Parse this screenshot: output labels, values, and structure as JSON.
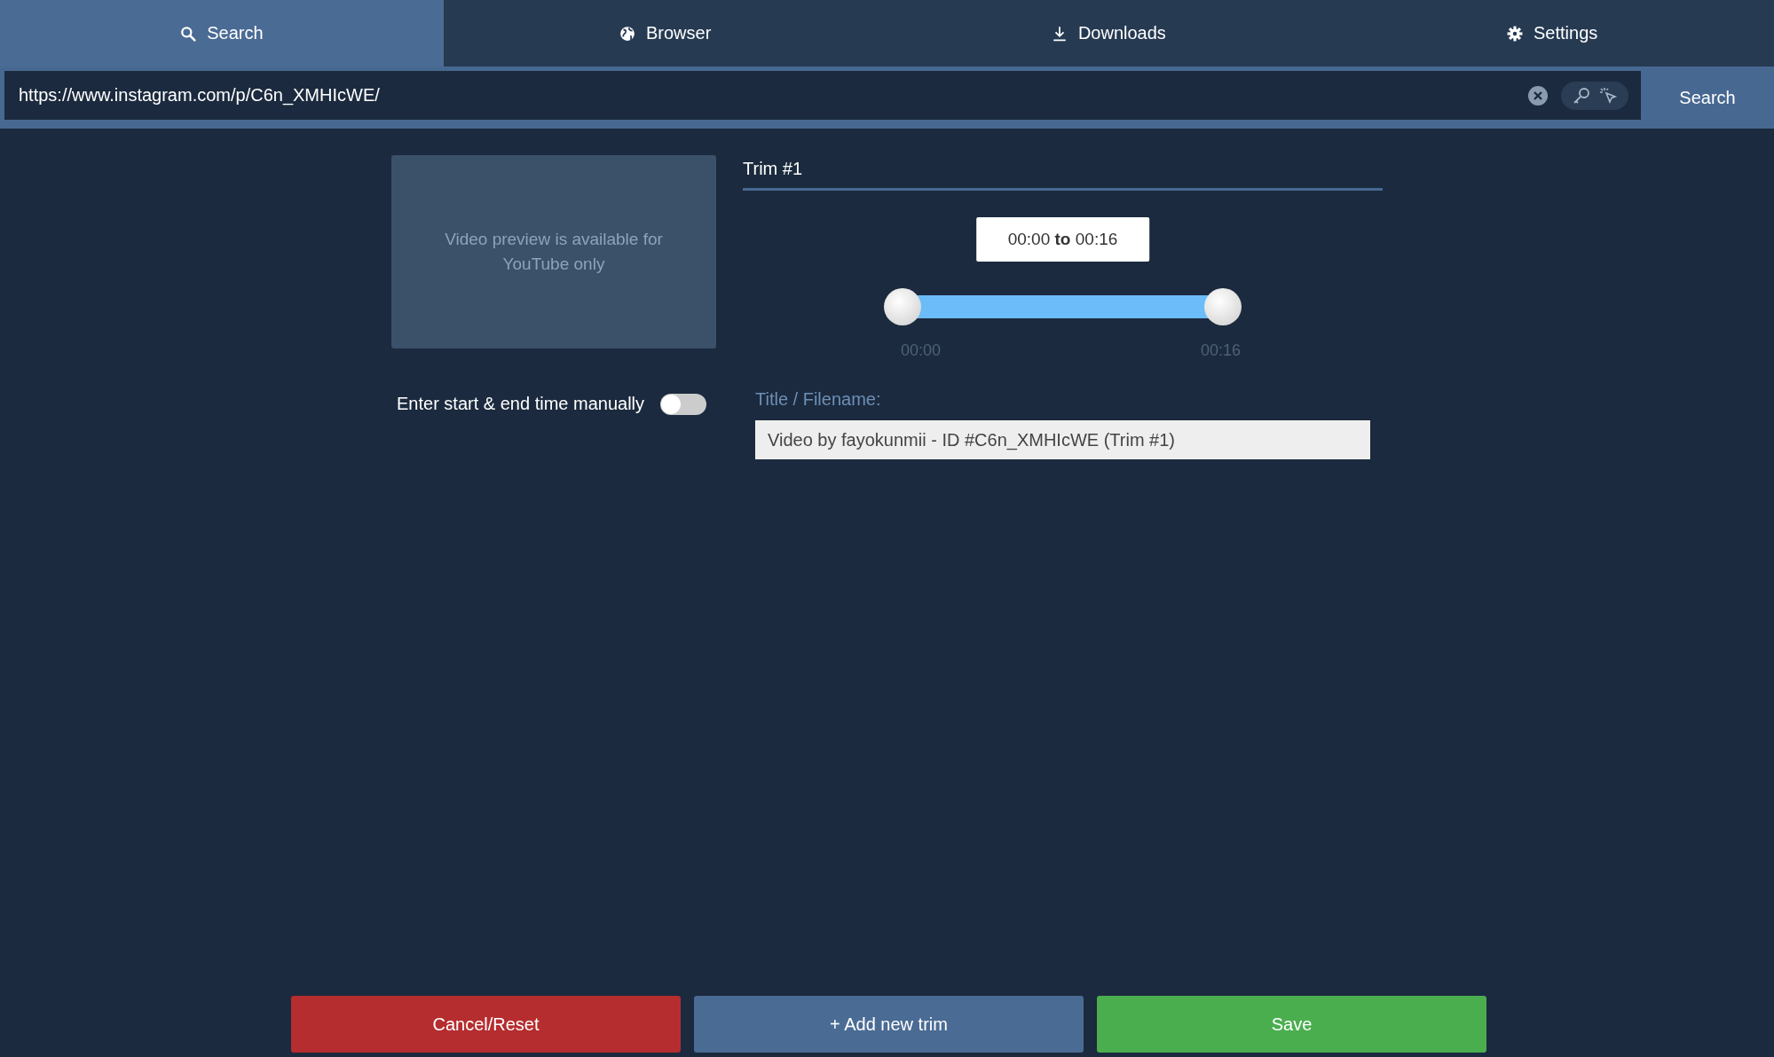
{
  "tabs": [
    {
      "label": "Search",
      "selected": true
    },
    {
      "label": "Browser",
      "selected": false
    },
    {
      "label": "Downloads",
      "selected": false
    },
    {
      "label": "Settings",
      "selected": false
    }
  ],
  "url_bar": {
    "value": "https://www.instagram.com/p/C6n_XMHIcWE/",
    "button": "Search"
  },
  "preview": {
    "message": "Video preview is available for YouTube only"
  },
  "manual_toggle": {
    "label": "Enter start & end time manually",
    "on": false
  },
  "trim": {
    "title": "Trim #1",
    "tooltip": "00:00 **to** 00:16",
    "thumbs": [
      {
        "level": 0
      },
      {
        "level": 1
      }
    ],
    "start_label": "00:00",
    "end_label": "00:16",
    "filename_label": "Title / Filename:",
    "filename": "Video by fayokunmii - ID #C6n_XMHIcWE (Trim #1)"
  },
  "buttons": [
    {
      "kind": "danger",
      "label": "Cancel/Reset"
    },
    {
      "kind": "secondary",
      "label": "+ Add new trim"
    },
    {
      "kind": "success",
      "label": "Save"
    }
  ]
}
